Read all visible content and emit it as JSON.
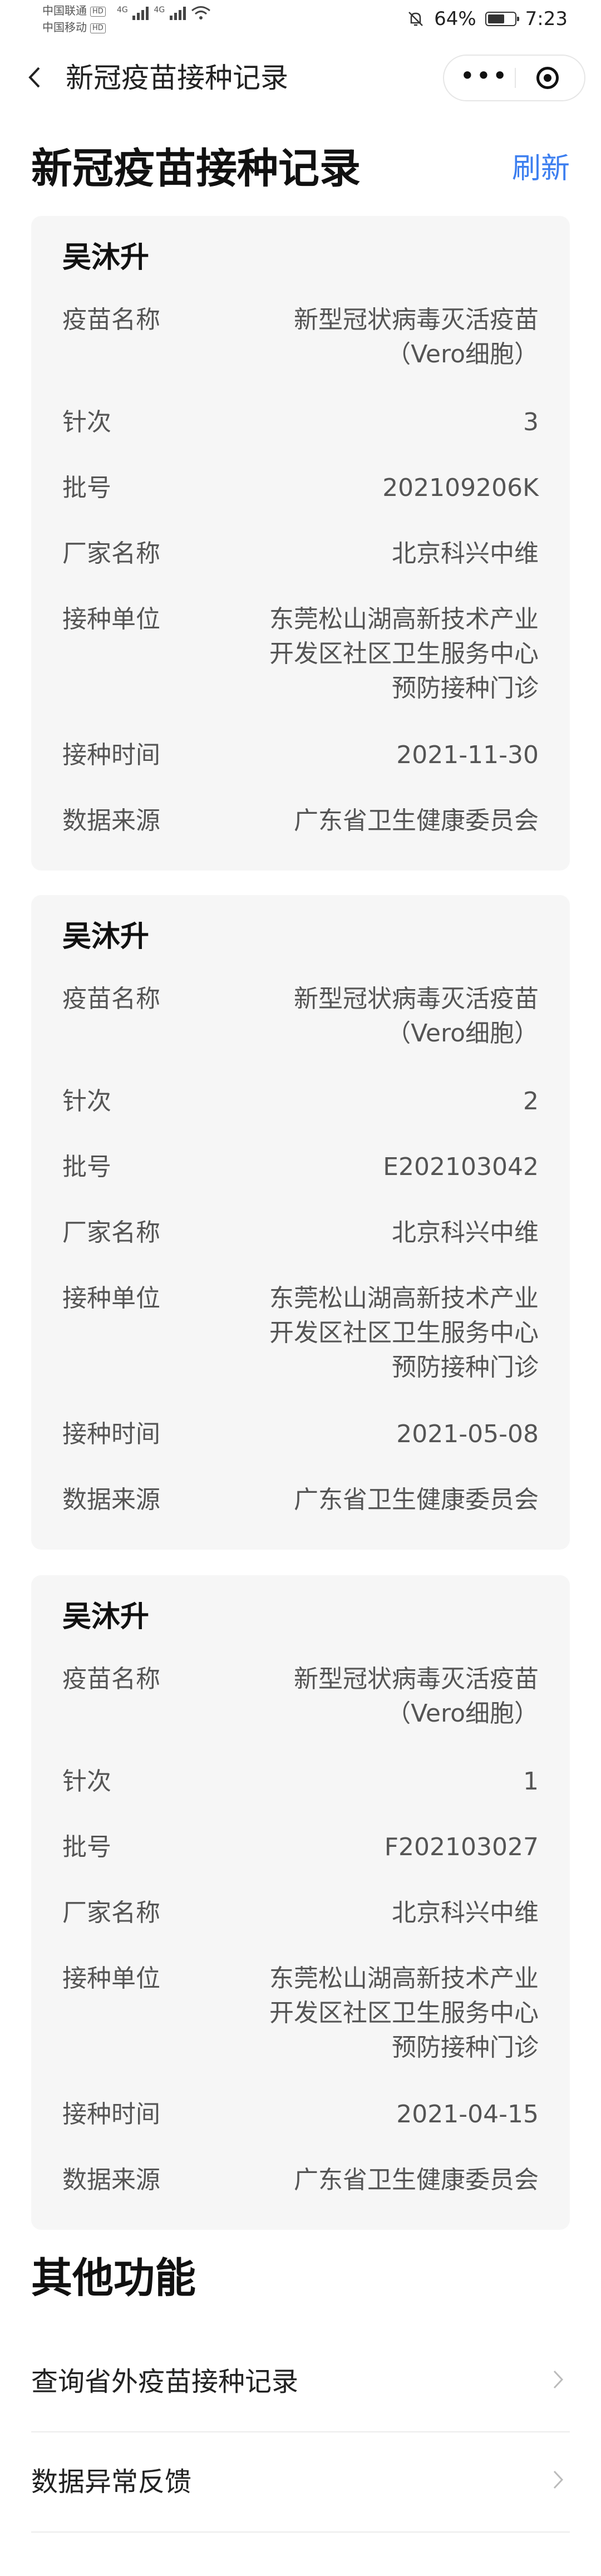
{
  "status_bar": {
    "carrier1": "中国联通",
    "carrier2": "中国移动",
    "hd": "HD",
    "net1": "4G",
    "net2": "4G",
    "battery_pct": "64%",
    "battery_level": 0.64,
    "time": "7:23"
  },
  "nav": {
    "back_icon": "chevron-left-icon",
    "title": "新冠疫苗接种记录",
    "more_icon": "•••",
    "target_icon": "target-icon"
  },
  "header": {
    "title": "新冠疫苗接种记录",
    "refresh": "刷新"
  },
  "records": [
    {
      "name": "吴沐升",
      "fields": [
        {
          "label": "疫苗名称",
          "value": "新型冠状病毒灭活疫苗\n（Vero细胞）"
        },
        {
          "label": "针次",
          "value": "3"
        },
        {
          "label": "批号",
          "value": "202109206K"
        },
        {
          "label": "厂家名称",
          "value": "北京科兴中维"
        },
        {
          "label": "接种单位",
          "value": "东莞松山湖高新技术产业\n开发区社区卫生服务中心\n预防接种门诊"
        },
        {
          "label": "接种时间",
          "value": "2021-11-30"
        },
        {
          "label": "数据来源",
          "value": "广东省卫生健康委员会"
        }
      ]
    },
    {
      "name": "吴沐升",
      "fields": [
        {
          "label": "疫苗名称",
          "value": "新型冠状病毒灭活疫苗\n（Vero细胞）"
        },
        {
          "label": "针次",
          "value": "2"
        },
        {
          "label": "批号",
          "value": "E202103042"
        },
        {
          "label": "厂家名称",
          "value": "北京科兴中维"
        },
        {
          "label": "接种单位",
          "value": "东莞松山湖高新技术产业\n开发区社区卫生服务中心\n预防接种门诊"
        },
        {
          "label": "接种时间",
          "value": "2021-05-08"
        },
        {
          "label": "数据来源",
          "value": "广东省卫生健康委员会"
        }
      ]
    },
    {
      "name": "吴沐升",
      "fields": [
        {
          "label": "疫苗名称",
          "value": "新型冠状病毒灭活疫苗\n（Vero细胞）"
        },
        {
          "label": "针次",
          "value": "1"
        },
        {
          "label": "批号",
          "value": "F202103027"
        },
        {
          "label": "厂家名称",
          "value": "北京科兴中维"
        },
        {
          "label": "接种单位",
          "value": "东莞松山湖高新技术产业\n开发区社区卫生服务中心\n预防接种门诊"
        },
        {
          "label": "接种时间",
          "value": "2021-04-15"
        },
        {
          "label": "数据来源",
          "value": "广东省卫生健康委员会"
        }
      ]
    }
  ],
  "other": {
    "title": "其他功能",
    "items": [
      {
        "label": "查询省外疫苗接种记录"
      },
      {
        "label": "数据异常反馈"
      }
    ]
  },
  "colors": {
    "accent": "#3d7ff0",
    "card_bg": "#f6f6f6"
  }
}
